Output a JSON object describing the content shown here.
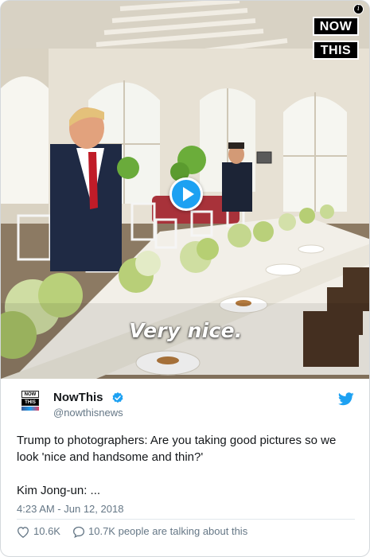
{
  "video": {
    "caption": "Very nice.",
    "brand_top": "NOW",
    "brand_bottom": "THIS",
    "info_glyph": "i",
    "play_icon": "play-icon"
  },
  "account": {
    "display_name": "NowThis",
    "handle": "@nowthisnews",
    "verified": true,
    "avatar_lines": [
      "NOW",
      "THIS"
    ]
  },
  "tweet": {
    "text": "Trump to photographers: Are you taking good pictures so we look 'nice and handsome and thin?'\n\nKim Jong-un: ...",
    "timestamp": "4:23 AM - Jun 12, 2018"
  },
  "actions": {
    "likes": "10.6K",
    "talking": "10.7K people are talking about this"
  },
  "colors": {
    "twitter_blue": "#1da1f2",
    "text": "#14171a",
    "muted": "#657786"
  }
}
